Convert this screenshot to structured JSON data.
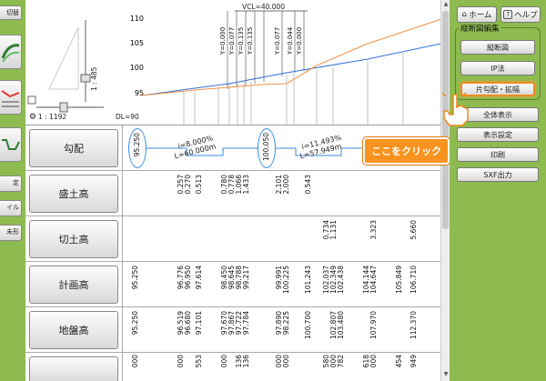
{
  "left_toolbar": {
    "items": [
      {
        "label": "切替"
      },
      {
        "label": ""
      },
      {
        "label": ""
      },
      {
        "label": ""
      },
      {
        "label": "定"
      },
      {
        "label": "イル"
      },
      {
        "label": "未形"
      }
    ]
  },
  "profile": {
    "vcl_label": "VCL=40.000",
    "y_ticks": [
      "110",
      "105",
      "100",
      "95"
    ],
    "y_annotations": [
      "Y=0.000",
      "Y=0.077",
      "Y=0.135",
      "Y=0.135",
      "Y=0.077",
      "Y=0.044",
      "Y=0.000"
    ],
    "vertical_scale": "1 : 485",
    "horizontal_scale": "1 : 1192",
    "dl_label": "DL=90",
    "colors": {
      "plan_line": "#3a6fd8",
      "ground_line": "#f0944c"
    }
  },
  "table": {
    "rows": [
      {
        "label": "勾配",
        "ellipses": [
          "95.250",
          "100.050"
        ],
        "segments": [
          {
            "slope": "i=8.000%",
            "length": "L=60.000m"
          },
          {
            "slope": "i=11.493%",
            "length": "L=57.949m"
          }
        ]
      },
      {
        "label": "盛土高",
        "values": [
          "0.257",
          "0.270",
          "0.513",
          "0.780",
          "0.778",
          "1.066",
          "1.433",
          "2.101",
          "2.000",
          "0.543"
        ]
      },
      {
        "label": "切土高",
        "values": [
          "0.734",
          "1.131",
          "3.323",
          "5.660"
        ]
      },
      {
        "label": "計画高",
        "values": [
          "95.250",
          "96.776",
          "96.950",
          "97.614",
          "98.450",
          "98.645",
          "98.788",
          "99.217",
          "99.991",
          "100.225",
          "101.243",
          "102.037",
          "102.349",
          "102.438",
          "104.144",
          "104.647",
          "105.849",
          "106.710"
        ]
      },
      {
        "label": "地盤高",
        "values": [
          "95.250",
          "96.519",
          "96.680",
          "97.101",
          "97.670",
          "97.867",
          "97.722",
          "97.784",
          "97.890",
          "98.225",
          "100.700",
          "102.807",
          "103.480",
          "107.970",
          "112.370"
        ]
      },
      {
        "label": "",
        "values": [
          "000",
          "000",
          "553",
          "000",
          "136",
          "136",
          "000",
          "000",
          "580",
          "000",
          "782",
          "618",
          "000",
          "454",
          "949"
        ]
      }
    ]
  },
  "right_panel": {
    "home_label": "ホーム",
    "help_label": "ヘルプ",
    "group_title": "縦断図編集",
    "buttons": {
      "profile": "縦断図",
      "ip": "IP法",
      "slope": "片勾配・拡幅",
      "show_all": "全体表示",
      "display_settings": "表示設定",
      "print": "印刷",
      "sxf": "SXF出力"
    }
  },
  "callout": {
    "text": "ここをクリック"
  }
}
